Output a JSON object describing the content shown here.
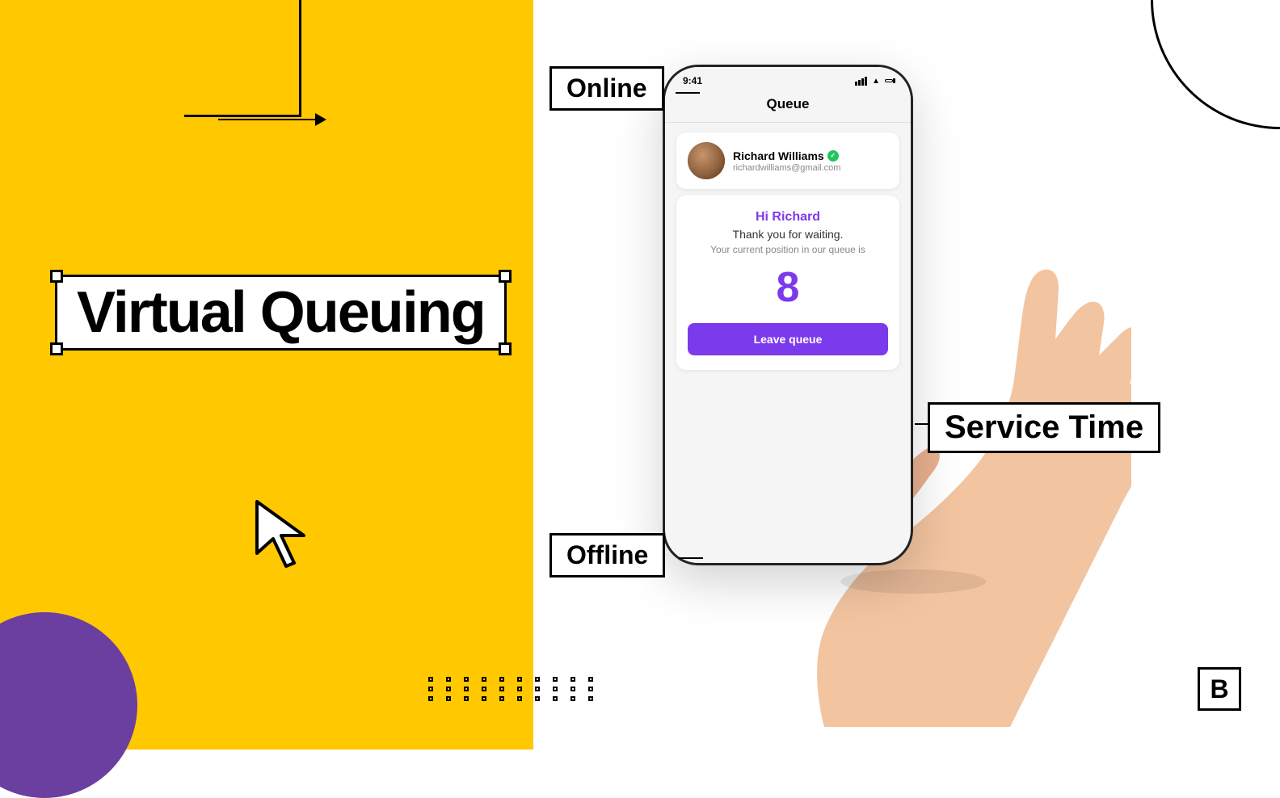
{
  "left": {
    "bg_color": "#FFC800"
  },
  "title": {
    "text": "Virtual Queuing"
  },
  "labels": {
    "online": "Online",
    "offline": "Offline",
    "service_time": "Service Time"
  },
  "phone": {
    "status_time": "9:41",
    "header_title": "Queue",
    "user": {
      "name": "Richard Williams",
      "email": "richardwilliams@gmail.com",
      "verified": true
    },
    "queue": {
      "greeting": "Hi Richard",
      "thank_you": "Thank you for waiting.",
      "position_label": "Your current position in our queue is",
      "position_number": "8",
      "leave_button": "Leave queue"
    }
  },
  "brand": {
    "logo": "B"
  }
}
